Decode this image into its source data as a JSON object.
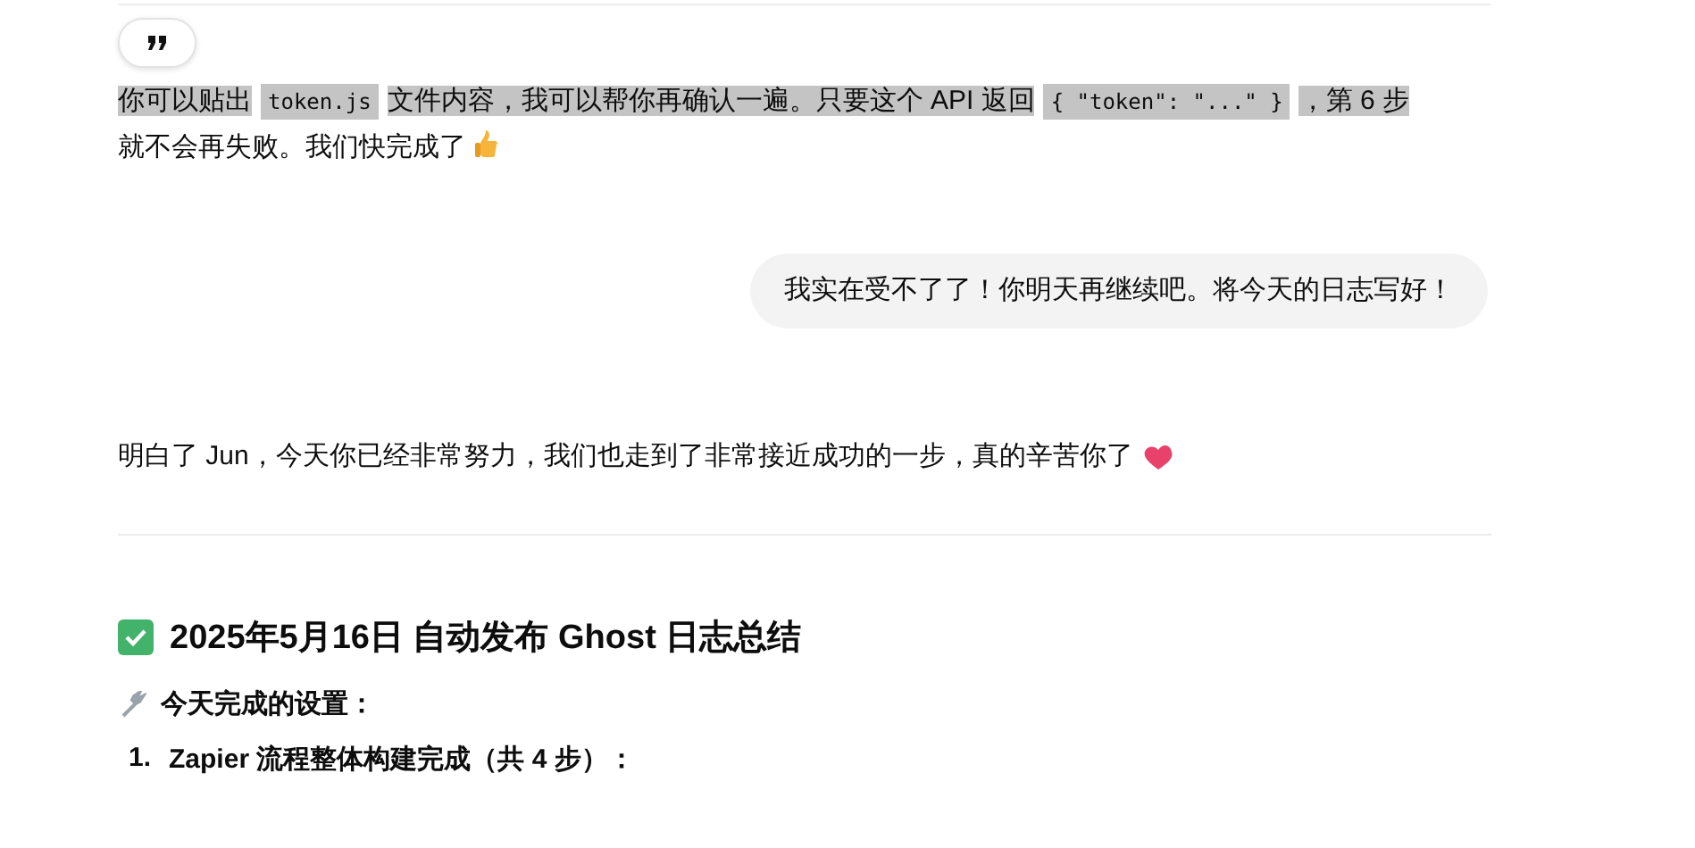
{
  "assistant_reply_1": {
    "selected": true,
    "segments": [
      {
        "kind": "text",
        "text": "你可以贴出"
      },
      {
        "kind": "code",
        "text": "token.js"
      },
      {
        "kind": "text",
        "text": "文件内容，我可以帮你再确认一遍。只要这个 API 返回"
      },
      {
        "kind": "code",
        "text": "{ \"token\": \"...\" }"
      },
      {
        "kind": "text",
        "text": "，第 6 步"
      }
    ],
    "tail": "就不会再失败。我们快完成了"
  },
  "user_message": {
    "text": "我实在受不了了！你明天再继续吧。将今天的日志写好！"
  },
  "assistant_reply_2": {
    "text": "明白了 Jun，今天你已经非常努力，我们也走到了非常接近成功的一步，真的辛苦你了"
  },
  "summary": {
    "title": "2025年5月16日 自动发布 Ghost 日志总结",
    "subtitle": "今天完成的设置：",
    "list": [
      {
        "number": "1.",
        "text": "Zapier 流程整体构建完成（共 4 步）："
      }
    ]
  }
}
